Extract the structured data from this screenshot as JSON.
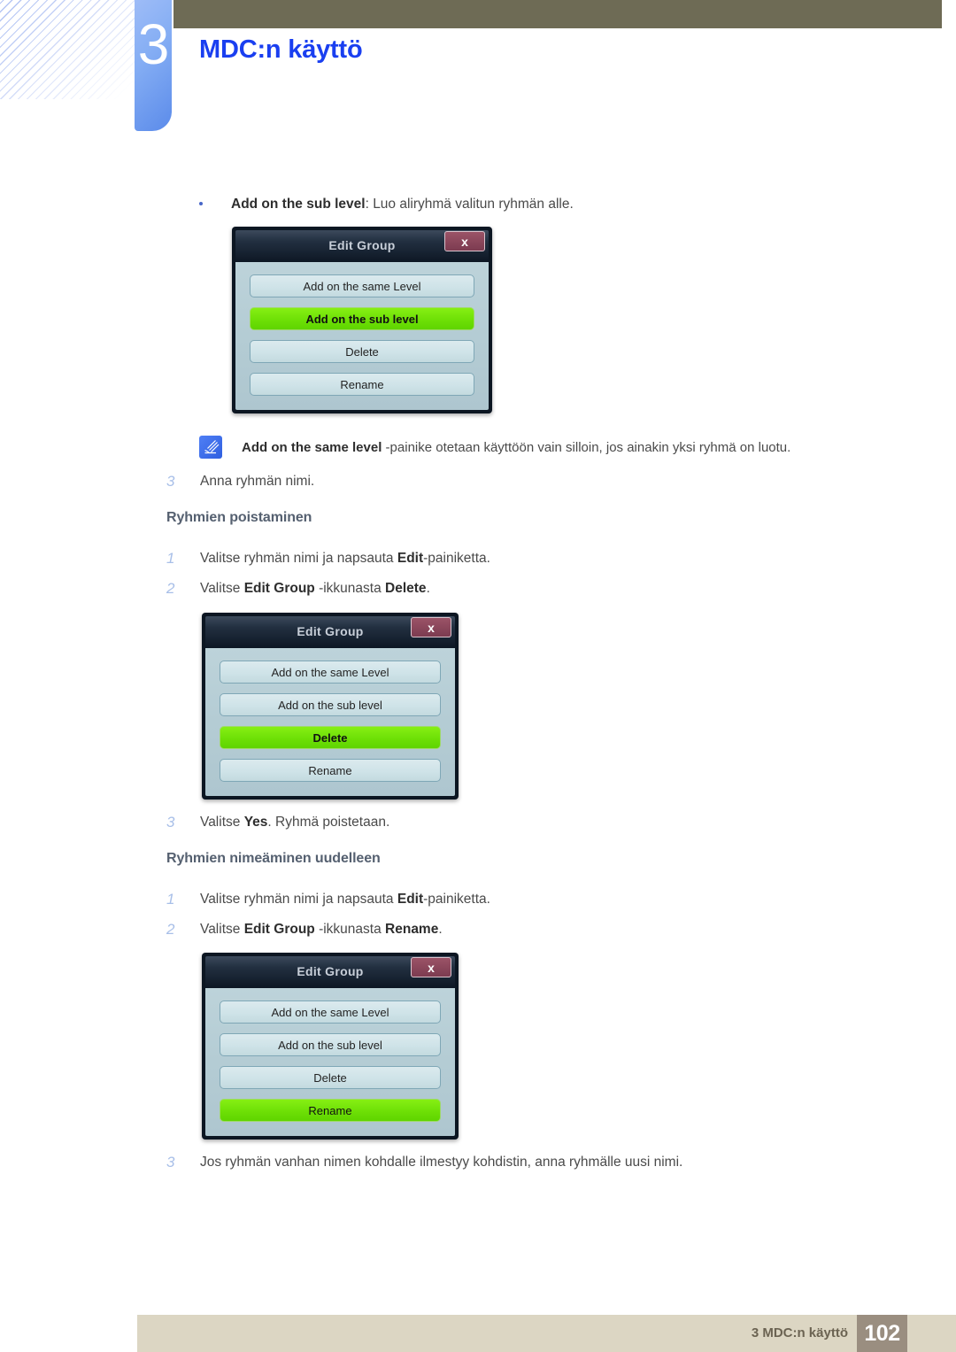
{
  "header": {
    "chapter_number": "3",
    "chapter_title": "MDC:n käyttö"
  },
  "content": {
    "bullet": {
      "term": "Add on the sub level",
      "rest": ": Luo aliryhmä valitun ryhmän alle."
    },
    "note": {
      "icon": "note-pen-icon",
      "term": "Add on the same level",
      "rest": " -painike otetaan käyttöön vain silloin, jos ainakin yksi ryhmä on luotu."
    },
    "step_a3": {
      "num": "3",
      "text": "Anna ryhmän nimi."
    },
    "heading_delete": "Ryhmien poistaminen",
    "step_b1": {
      "num": "1",
      "pre": "Valitse ryhmän nimi ja napsauta ",
      "bold": "Edit",
      "post": "-painiketta."
    },
    "step_b2": {
      "num": "2",
      "pre": "Valitse ",
      "bold1": "Edit Group",
      "mid": " -ikkunasta ",
      "bold2": "Delete",
      "post": "."
    },
    "step_b3": {
      "num": "3",
      "pre": "Valitse ",
      "bold": "Yes",
      "post": ". Ryhmä poistetaan."
    },
    "heading_rename": "Ryhmien nimeäminen uudelleen",
    "step_c1": {
      "num": "1",
      "pre": "Valitse ryhmän nimi ja napsauta ",
      "bold": "Edit",
      "post": "-painiketta."
    },
    "step_c2": {
      "num": "2",
      "pre": "Valitse ",
      "bold1": "Edit Group",
      "mid": " -ikkunasta ",
      "bold2": "Rename",
      "post": "."
    },
    "step_c3": {
      "num": "3",
      "text": "Jos ryhmän vanhan nimen kohdalle ilmestyy kohdistin, anna ryhmälle uusi nimi."
    }
  },
  "dialogs": [
    {
      "title": "Edit Group",
      "close_label": "x",
      "buttons": [
        {
          "label": "Add on the same Level",
          "active": false
        },
        {
          "label": "Add on the sub level",
          "active": true
        },
        {
          "label": "Delete",
          "active": false
        },
        {
          "label": "Rename",
          "active": false
        }
      ]
    },
    {
      "title": "Edit Group",
      "close_label": "x",
      "buttons": [
        {
          "label": "Add on the same Level",
          "active": false
        },
        {
          "label": "Add on the sub level",
          "active": false
        },
        {
          "label": "Delete",
          "active": true
        },
        {
          "label": "Rename",
          "active": false
        }
      ]
    },
    {
      "title": "Edit Group",
      "close_label": "x",
      "buttons": [
        {
          "label": "Add on the same Level",
          "active": false
        },
        {
          "label": "Add on the sub level",
          "active": false
        },
        {
          "label": "Delete",
          "active": false
        },
        {
          "label": "Rename",
          "active": true
        }
      ]
    }
  ],
  "footer": {
    "text": "3 MDC:n käyttö",
    "page": "102"
  },
  "colors": {
    "chapter_title": "#1a3ff0",
    "olive_bar": "#6e6b55",
    "tab_blue": "#85aef4",
    "step_number": "#a8bfe8",
    "heading": "#556070",
    "dialog_active_green": "#6ee006",
    "dialog_close_red": "#7c3b50",
    "footer_band": "#dcd6c3",
    "footer_pagebox": "#9a8e80"
  }
}
